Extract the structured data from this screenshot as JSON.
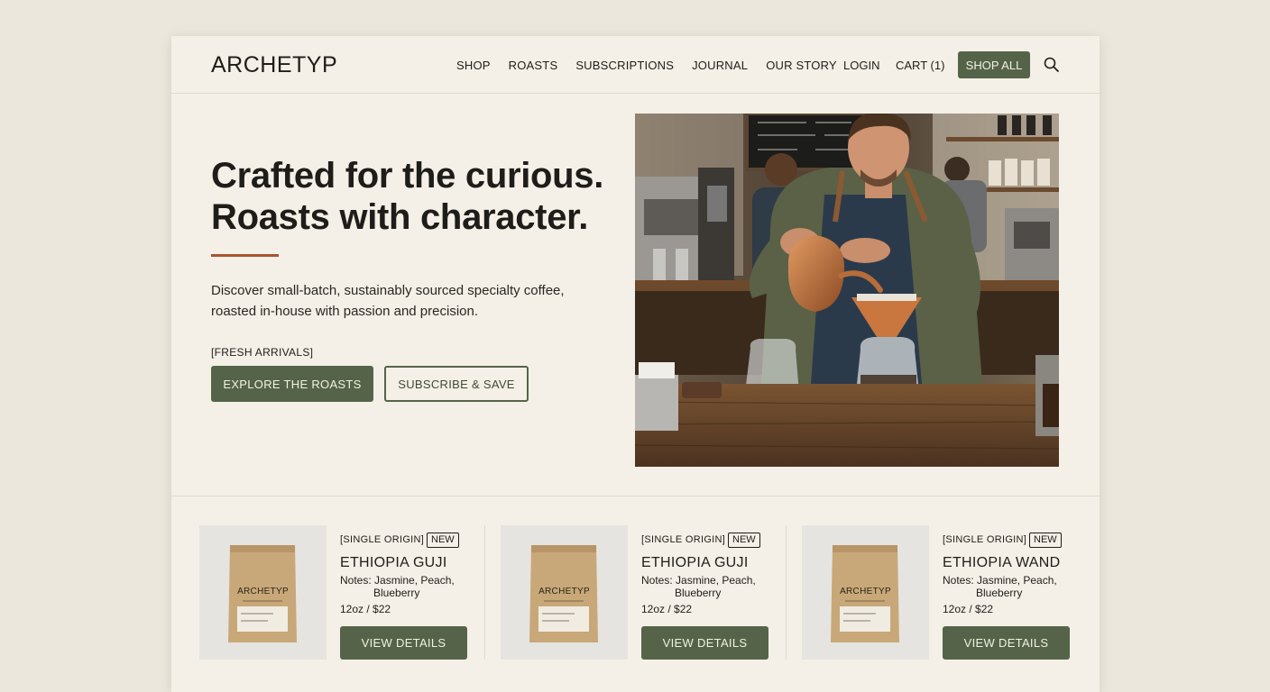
{
  "header": {
    "logo": "ARCHETYP",
    "nav": [
      "SHOP",
      "ROASTS",
      "SUBSCRIPTIONS",
      "JOURNAL",
      "OUR STORY"
    ],
    "login": "LOGIN",
    "cart": "CART (1)",
    "shop_all": "SHOP ALL",
    "search_icon": "search-icon"
  },
  "hero": {
    "title_line1": "Crafted for the curious.",
    "title_line2": "Roasts with character.",
    "description_line1": "Discover small-batch, sustainably sourced specialty coffee,",
    "description_line2": "roasted in-house with passion and precision.",
    "tag": "[FRESH ARRIVALS]",
    "primary_button": "EXPLORE THE ROASTS",
    "secondary_button": "SUBSCRIBE & SAVE",
    "image": "barista-pour-over-photo"
  },
  "products": [
    {
      "bag_brand": "ARCHETYP",
      "category": "[SINGLE ORIGIN]",
      "badge": "NEW",
      "name": "ETHIOPIA GUJI",
      "notes_line1": "Notes: Jasmine, Peach,",
      "notes_line2": "Blueberry",
      "price": "12oz / $22",
      "button": "VIEW DETAILS"
    },
    {
      "bag_brand": "ARCHETYP",
      "category": "[SINGLE ORIGIN]",
      "badge": "NEW",
      "name": "ETHIOPIA GUJI",
      "notes_line1": "Notes: Jasmine, Peach,",
      "notes_line2": "Blueberry",
      "price": "12oz / $22",
      "button": "VIEW DETAILS"
    },
    {
      "bag_brand": "ARCHETYP",
      "category": "[SINGLE ORIGIN]",
      "badge": "NEW",
      "name": "ETHIOPIA WAND",
      "notes_line1": "Notes: Jasmine, Peach,",
      "notes_line2": "Blueberry",
      "price": "12oz / $22",
      "button": "VIEW DETAILS"
    }
  ],
  "colors": {
    "page_background": "#ebe7dc",
    "card_background": "#f4f0e7",
    "primary_green": "#556448",
    "accent_rust": "#a9542b",
    "text": "#1f1d1a"
  }
}
